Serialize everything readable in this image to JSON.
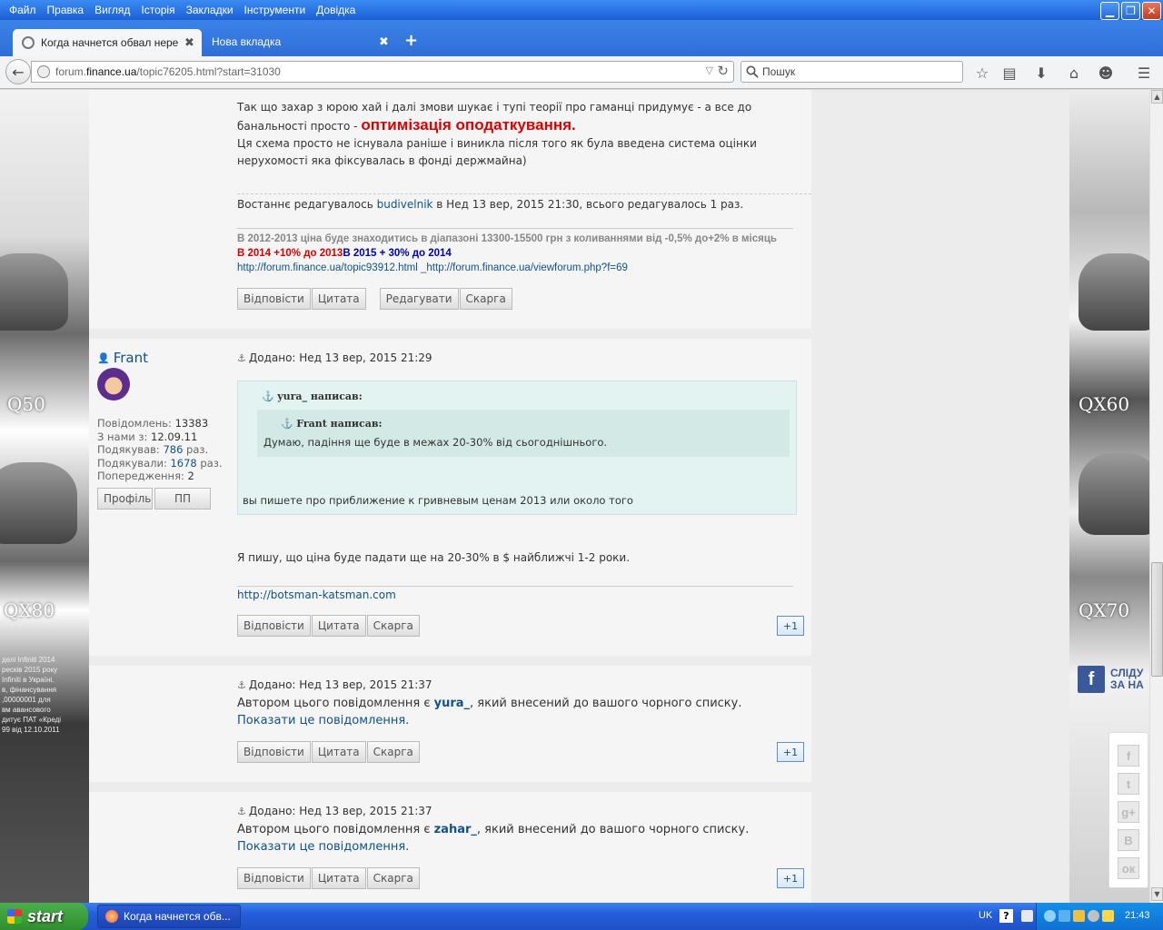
{
  "menu": [
    "Файл",
    "Правка",
    "Вигляд",
    "Історія",
    "Закладки",
    "Інструменти",
    "Довідка"
  ],
  "window_buttons": {
    "minimize": "▁",
    "maximize": "❐",
    "close": "✕"
  },
  "tabs": [
    {
      "title": "Когда начнется обвал нере...",
      "close": "✖"
    },
    {
      "title": "Нова вкладка",
      "close": "✖"
    }
  ],
  "new_tab_symbol": "+",
  "url": {
    "prefix": "forum.",
    "host": "finance.ua",
    "path": "/topic76205.html?start=31030"
  },
  "search": {
    "placeholder": "Пошук"
  },
  "post1": {
    "text_before": "Так що захар з юрою хай і далі змови шукає і тупі теорії про гаманці придумує - а все до банальності просто - ",
    "highlight": "оптимізація оподаткування.",
    "text_after": "Ця схема просто не існувала раніше і виникла після того як була введена система оцінки нерухомості яка фіксувалась в фонді держмайна)",
    "edit_prefix": "Востаннє редагувалось ",
    "edit_user": "budivelnik",
    "edit_suffix": " в Нед 13 вер, 2015 21:30, всього редагувалось 1 раз.",
    "sig_line1": "В 2012-2013 ціна буде знаходитись в діапазоні 13300-15500 грн з коливаннями від -0,5% до+2% в місяць",
    "sig_red": "В 2014 +10% до 2013",
    "sig_blue": "В 2015 + 30% до 2014",
    "sig_links": "http://forum.finance.ua/topic93912.html _http://forum.finance.ua/viewforum.php?f=69",
    "buttons": [
      "Відповісти",
      "Цитата",
      "Редагувати",
      "Скарга"
    ]
  },
  "post2": {
    "author": "Frant",
    "posted": "Додано: Нед 13 вер, 2015 21:29",
    "stats": [
      {
        "label": "Повідомлень:",
        "value": "13383",
        "link": false
      },
      {
        "label": "З нами з:",
        "value": "12.09.11",
        "link": false
      },
      {
        "label": "Подякував:",
        "value": "786",
        "suffix": " раз.",
        "link": true
      },
      {
        "label": "Подякували:",
        "value": "1678",
        "suffix": " раз.",
        "link": true
      },
      {
        "label": "Попередження:",
        "value": "2",
        "link": false
      }
    ],
    "profile_btn": "Профіль",
    "pm_btn": "ПП",
    "quote_outer_author": "yura_ написав:",
    "quote_inner_author": "Frant написав:",
    "quote_inner_text": "Думаю, падіння ще буде в межах 20-30% від сьогоднішнього.",
    "quote_outer_text": "вы пишете про приближение к гривневым ценам 2013 или около того",
    "text": "Я пишу, що ціна буде падати ще на 20-30% в $ найближчі 1-2 роки.",
    "signature": "http://botsman-katsman.com",
    "buttons": [
      "Відповісти",
      "Цитата",
      "Скарга"
    ],
    "plus": "+1"
  },
  "post3": {
    "posted": "Додано: Нед 13 вер, 2015 21:37",
    "prefix": "Автором цього повідомлення є ",
    "user": "yura_",
    "middle": ", який внесений до вашого чорного списку. ",
    "show_link": "Показати це повідомлення",
    "end": ".",
    "buttons": [
      "Відповісти",
      "Цитата",
      "Скарга"
    ],
    "plus": "+1"
  },
  "post4": {
    "posted": "Додано: Нед 13 вер, 2015 21:37",
    "prefix": "Автором цього повідомлення є ",
    "user": "zahar_",
    "middle": ", який внесений до вашого чорного списку. ",
    "show_link": "Показати це повідомлення",
    "end": ".",
    "buttons": [
      "Відповісти",
      "Цитата",
      "Скарга"
    ],
    "plus": "+1"
  },
  "ads": {
    "left_models": [
      "Q50",
      "QX80"
    ],
    "right_models": [
      "QX60",
      "QX70"
    ],
    "left_fine_print": "делі Infiniti 2014\nресків 2015 року\nInfiniti в Україні.\nв, фінансування\n,00000001 для\nвм авансового\nдитує ПАТ «Креді\n99 від 12.10.2011"
  },
  "fb_follow": "СЛІДУ\nЗА НА",
  "share_icons": [
    "f",
    "t",
    "g+",
    "В",
    "ок"
  ],
  "taskbar": {
    "start": "start",
    "task": "Когда начнется обв...",
    "lang": "UK",
    "help": "?",
    "clock": "21:43"
  }
}
